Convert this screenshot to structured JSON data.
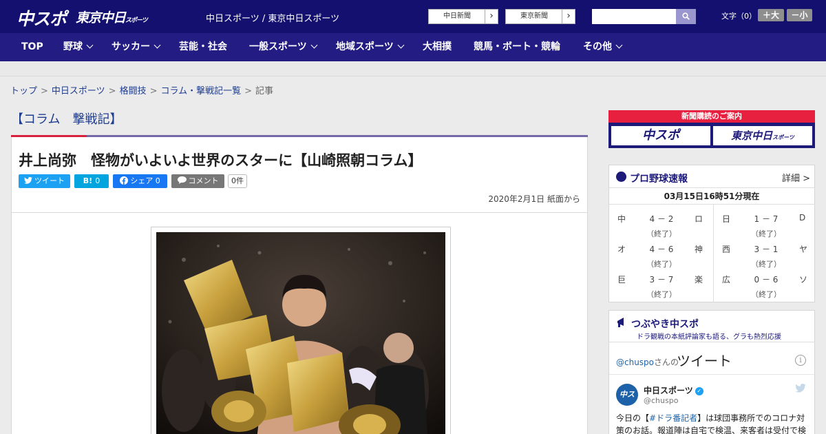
{
  "header": {
    "logo_main": "中スポ",
    "logo_sub": "東京中日",
    "logo_sub_small": "スポーツ",
    "site_names": "中日スポーツ / 東京中日スポーツ",
    "paper_links": [
      "中日新聞",
      "東京新聞"
    ],
    "search_placeholder": "",
    "font_size_label": "文字（0）",
    "font_plus": "＋大",
    "font_minus": "－小"
  },
  "nav": {
    "items": [
      "TOP",
      "野球",
      "サッカー",
      "芸能・社会",
      "一般スポーツ",
      "地域スポーツ",
      "大相撲",
      "競馬・ボート・競輪",
      "その他"
    ]
  },
  "breadcrumb": {
    "items": [
      "トップ",
      "中日スポーツ",
      "格闘技",
      "コラム・撃戦記一覧"
    ],
    "current": "記事",
    "separator": ">"
  },
  "article": {
    "section_title": "【コラム　撃戦記】",
    "title": "井上尚弥　怪物がいよいよ世界のスターに【山崎照朝コラム】",
    "share": {
      "tweet": "ツイート",
      "hatena_icon": "B!",
      "hatena_count": "0",
      "fb_share": "シェア 0",
      "comment": "コメント",
      "comment_count": "0件"
    },
    "date": "2020年2月1日 紙面から"
  },
  "sidebar": {
    "subscription": {
      "heading": "新聞購読のご案内",
      "logos": [
        "中スポ",
        "東京中日"
      ],
      "logo_small": "スポーツ"
    },
    "baseball": {
      "title": "プロ野球速報",
      "more": "詳細 >",
      "timestamp": "03月15日16時51分現在",
      "games": [
        {
          "home": "中",
          "score": "4 － 2",
          "away": "ロ",
          "status": "（終了）"
        },
        {
          "home": "日",
          "score": "1 － 7",
          "away": "D",
          "status": "（終了）"
        },
        {
          "home": "オ",
          "score": "4 － 6",
          "away": "神",
          "status": "（終了）"
        },
        {
          "home": "西",
          "score": "3 － 1",
          "away": "ヤ",
          "status": "（終了）"
        },
        {
          "home": "巨",
          "score": "3 － 7",
          "away": "楽",
          "status": "（終了）"
        },
        {
          "home": "広",
          "score": "0 － 6",
          "away": "ソ",
          "status": "（終了）"
        }
      ]
    },
    "tweets": {
      "title": "つぶやき中スポ",
      "subtitle": "ドラ観戦の本紙評論家も語る、グラも熱烈応援",
      "handle": "@chuspo",
      "handle_suffix": "さんの",
      "big_label": "ツイート",
      "info_icon": "i",
      "avatar": "中スポ",
      "name": "中日スポーツ",
      "user": "@chuspo",
      "text_pre": "今日の【",
      "text_tag": "#ドラ番記者",
      "text_post": "】は球団事務所でのコロナ対策のお話。報道陣は自宅で検温、来客者は受付で検"
    }
  },
  "colors": {
    "header_bg": "#141070",
    "nav_bg": "#231d83",
    "accent_red": "#d8203c",
    "link_blue": "#1f3d8f",
    "twitter_blue": "#1da1f2",
    "hatena_blue": "#00a4de",
    "facebook_blue": "#1877f2",
    "comment_gray": "#777777"
  }
}
